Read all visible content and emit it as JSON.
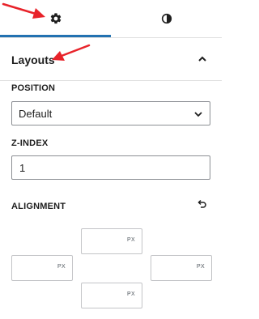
{
  "tabs": {
    "settings_icon": "gear-icon",
    "styles_icon": "contrast-icon",
    "active_color": "#2271b1"
  },
  "panel": {
    "title": "Layouts",
    "toggle_icon": "chevron-up-icon"
  },
  "position": {
    "label": "POSITION",
    "value": "Default"
  },
  "zindex": {
    "label": "Z-INDEX",
    "value": "1"
  },
  "alignment": {
    "label": "ALIGNMENT",
    "reset_icon": "undo-icon",
    "top_unit": "PX",
    "left_unit": "PX",
    "right_unit": "PX",
    "bottom_unit": "PX"
  },
  "annotation": {
    "arrow_color": "#e8232a"
  }
}
